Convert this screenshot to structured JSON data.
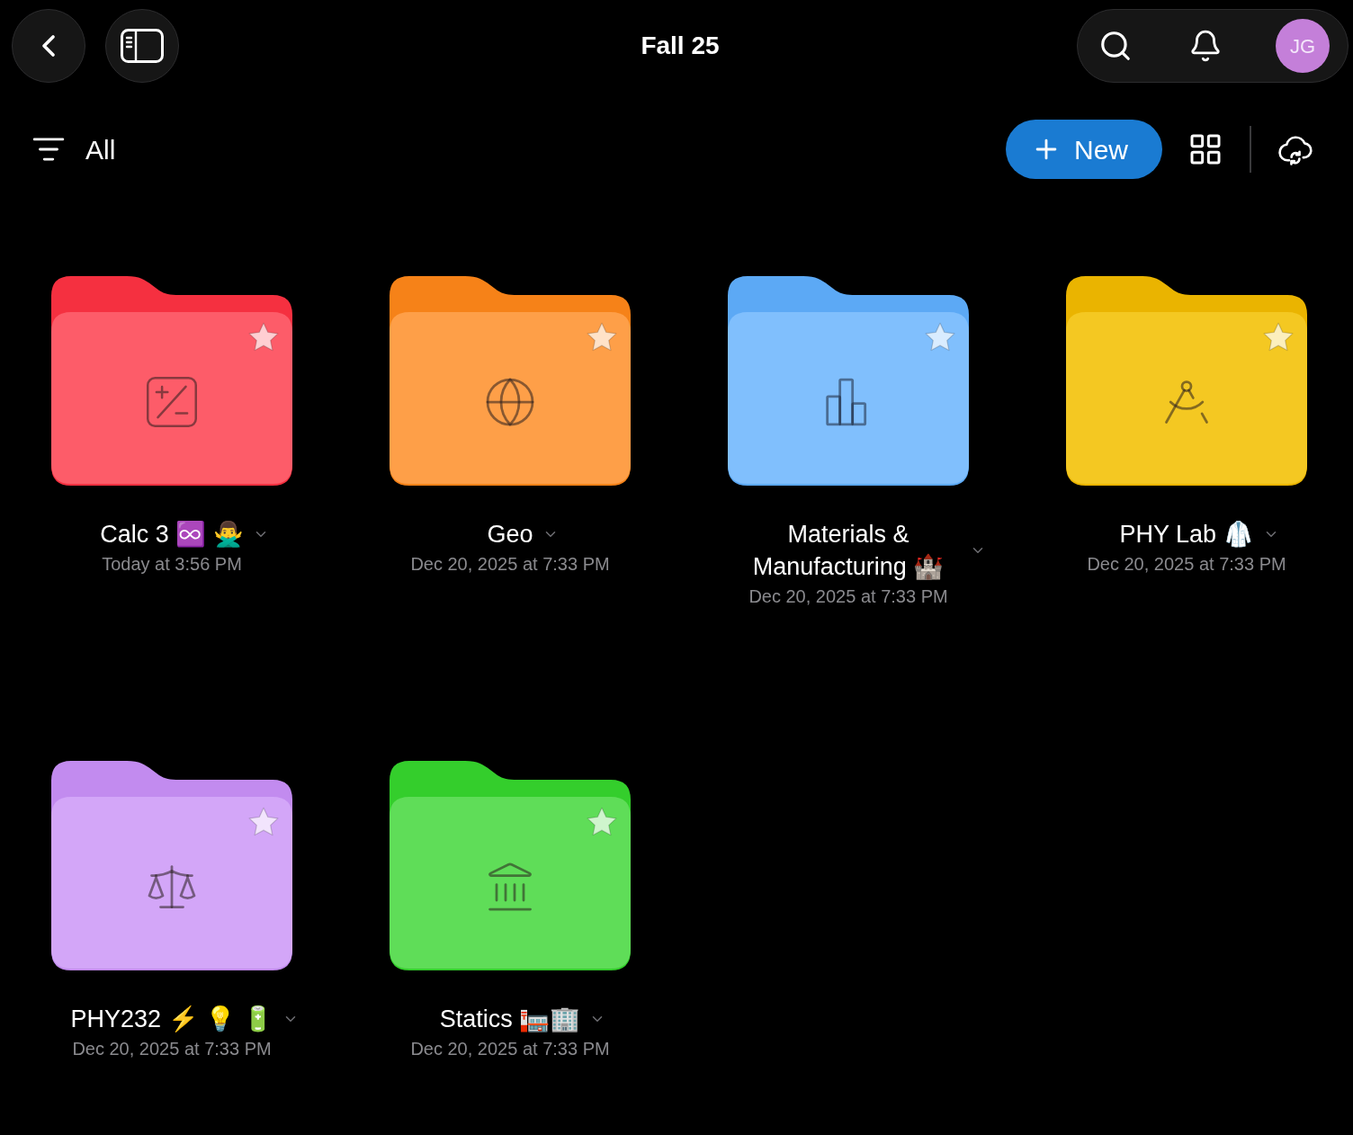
{
  "header": {
    "title": "Fall 25",
    "avatar_initials": "JG"
  },
  "toolbar": {
    "filter_label": "All",
    "new_label": "New"
  },
  "folders": [
    {
      "name": "Calc 3 ♾️ 🙅‍♂️",
      "date": "Today at 3:56 PM",
      "color": "#fd5c69",
      "kind": "math"
    },
    {
      "name": "Geo",
      "date": "Dec 20, 2025 at 7:33 PM",
      "color": "#fe9f48",
      "kind": "globe"
    },
    {
      "name": "Materials & Manufacturing 🏰",
      "date": "Dec 20, 2025 at 7:33 PM",
      "color": "#80bffd",
      "kind": "chart"
    },
    {
      "name": "PHY Lab 🥼",
      "date": "Dec 20, 2025 at 7:33 PM",
      "color": "#f4c822",
      "kind": "compass"
    },
    {
      "name": "PHY232 ⚡ 💡 🔋",
      "date": "Dec 20, 2025 at 7:33 PM",
      "color": "#d3a6f8",
      "kind": "scales"
    },
    {
      "name": "Statics 🏣🏢",
      "date": "Dec 20, 2025 at 7:33 PM",
      "color": "#5fdd58",
      "kind": "bank"
    }
  ]
}
